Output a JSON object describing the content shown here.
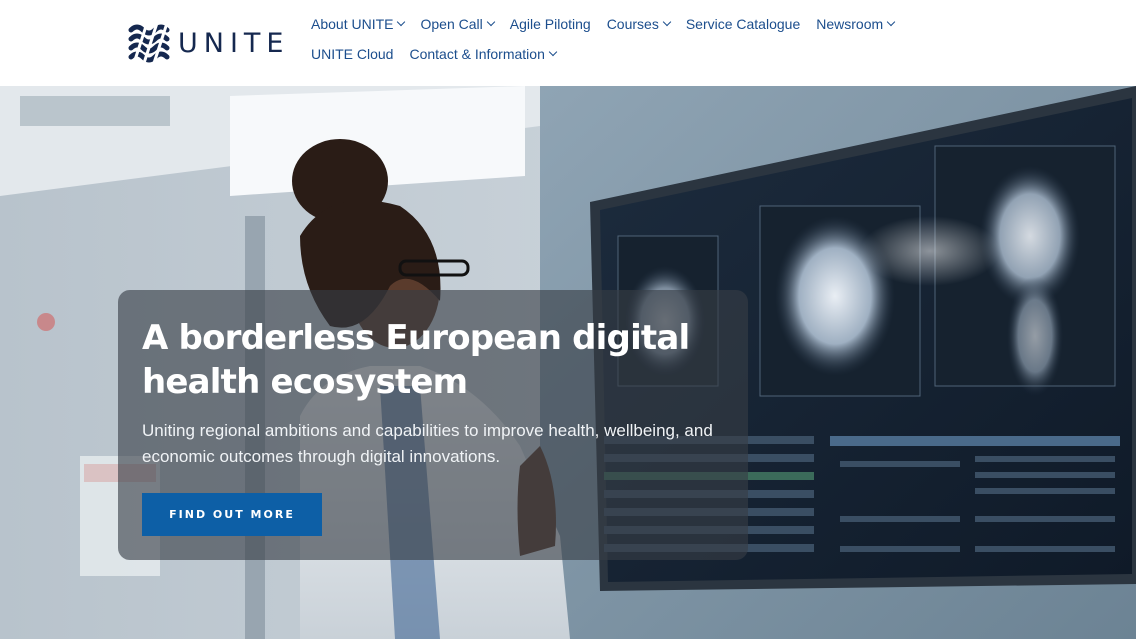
{
  "brand": {
    "name": "UNITE",
    "logo_icon": "unite-waves-logo",
    "colors": {
      "navy": "#15284f",
      "link": "#1c4e8d",
      "button": "#0d5fa6"
    }
  },
  "nav": {
    "items": [
      {
        "label": "About UNITE",
        "has_dropdown": true
      },
      {
        "label": "Open Call",
        "has_dropdown": true
      },
      {
        "label": "Agile Piloting",
        "has_dropdown": false
      },
      {
        "label": "Courses",
        "has_dropdown": true
      },
      {
        "label": "Service Catalogue",
        "has_dropdown": false
      },
      {
        "label": "Newsroom",
        "has_dropdown": true
      },
      {
        "label": "UNITE Cloud",
        "has_dropdown": false
      },
      {
        "label": "Contact & Information",
        "has_dropdown": true
      }
    ]
  },
  "hero": {
    "title": "A borderless European digital health ecosystem",
    "subtitle": "Uniting regional ambitions and capabilities to improve health, wellbeing, and economic outcomes through digital innovations.",
    "cta_label": "FIND OUT MORE"
  }
}
